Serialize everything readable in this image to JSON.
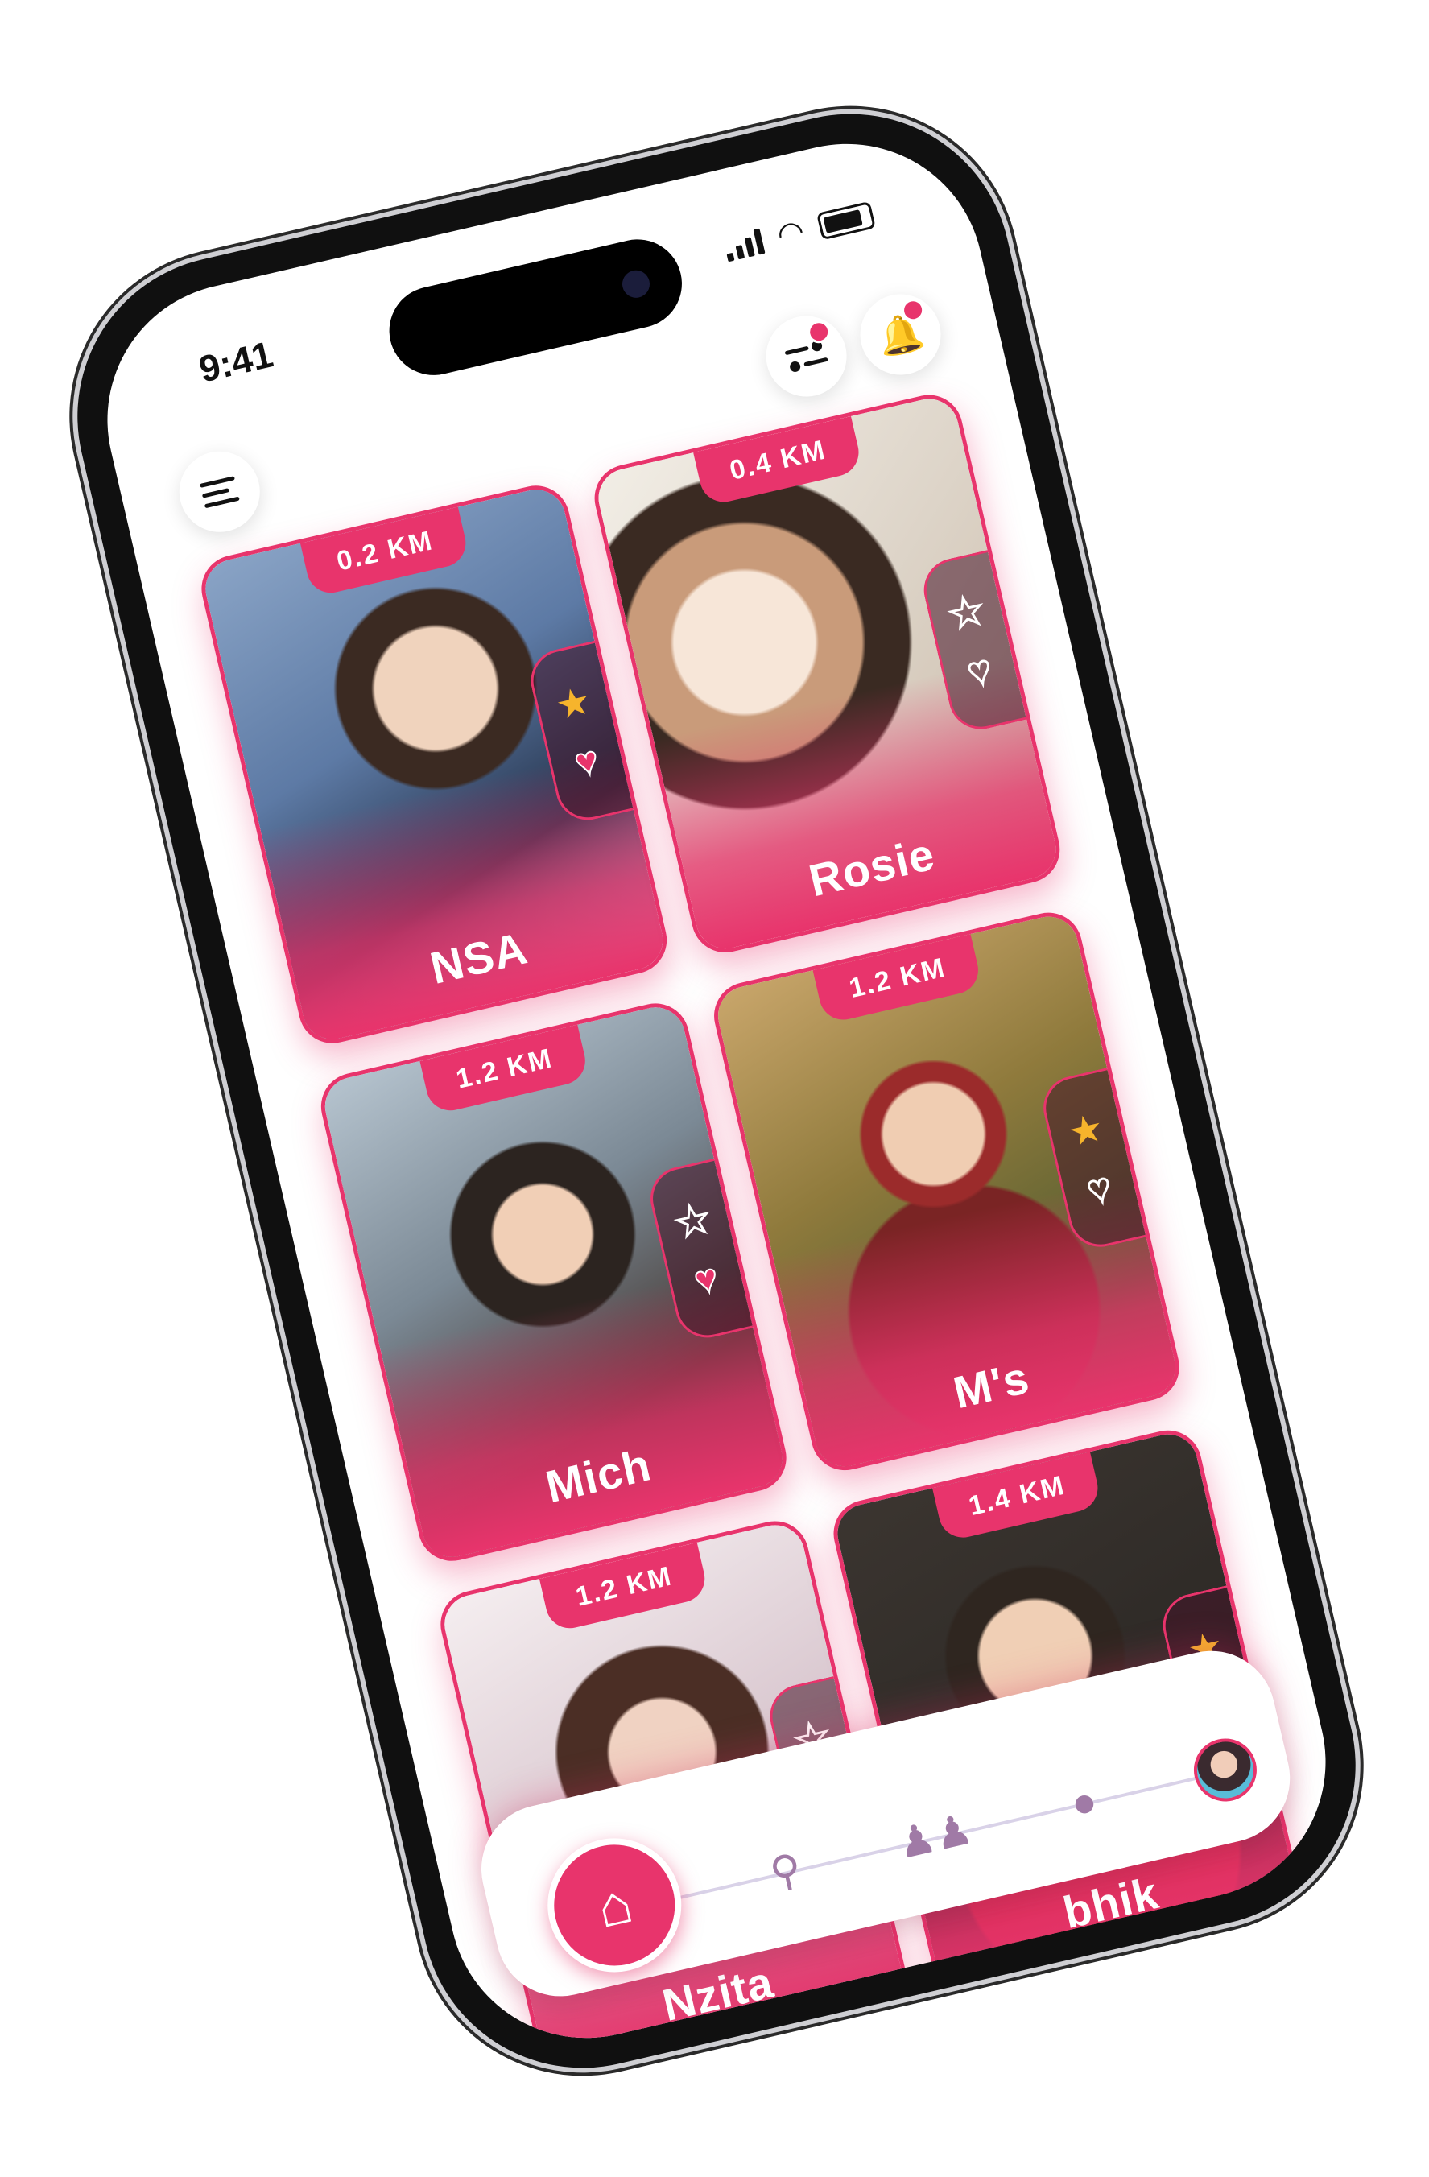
{
  "status_bar": {
    "time": "9:41"
  },
  "header": {
    "menu_icon": "hamburger-icon",
    "filter_icon": "filter-icon",
    "bell_icon": "bell-icon"
  },
  "profiles": [
    {
      "name": "NSA",
      "distance": "0.2 KM",
      "starred": true,
      "liked": true
    },
    {
      "name": "Rosie",
      "distance": "0.4 KM",
      "starred": false,
      "liked": false
    },
    {
      "name": "Mich",
      "distance": "1.2 KM",
      "starred": false,
      "liked": true
    },
    {
      "name": "M's",
      "distance": "1.2 KM",
      "starred": true,
      "liked": false
    },
    {
      "name": "Nzita",
      "distance": "1.2 KM",
      "starred": false,
      "liked": false
    },
    {
      "name": "bhik",
      "distance": "1.4 KM",
      "starred": true,
      "liked": true
    }
  ],
  "nav": {
    "items": [
      "home-icon",
      "search-icon",
      "people-icon",
      "chat-icon",
      "profile-avatar"
    ]
  },
  "colors": {
    "accent": "#e8346c",
    "star": "#f6b42c",
    "nav_icon": "#a07aa6"
  }
}
